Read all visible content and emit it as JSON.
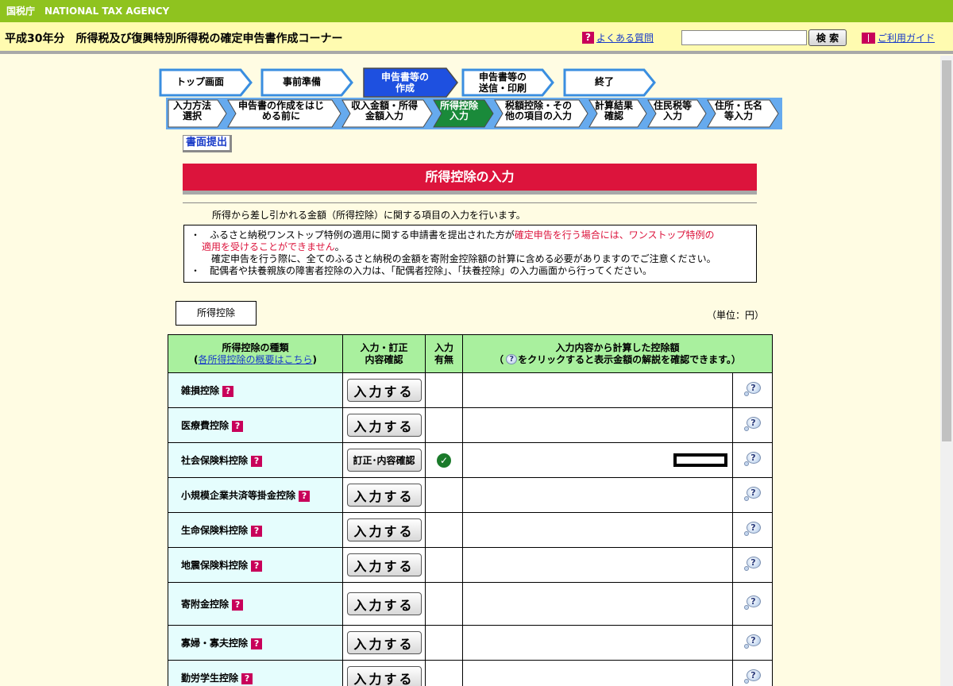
{
  "agency_header": "国税庁　NATIONAL TAX AGENCY",
  "main_title": "平成30年分　所得税及び復興特別所得税の確定申告書作成コーナー",
  "header": {
    "faq_label": "よくある質問",
    "search_placeholder": "",
    "search_button": "検 索",
    "guide_label": "ご利用ガイド"
  },
  "steps": [
    {
      "label": "トップ画面",
      "active": false
    },
    {
      "label": "事前準備",
      "active": false
    },
    {
      "label1": "申告書等の",
      "label2": "作成",
      "active": true
    },
    {
      "label1": "申告書等の",
      "label2": "送信・印刷",
      "active": false
    },
    {
      "label": "終了",
      "active": false
    }
  ],
  "substeps": [
    {
      "label1": "入力方法",
      "label2": "選択"
    },
    {
      "label1": "申告書の作成をはじ",
      "label2": "める前に"
    },
    {
      "label1": "収入金額・所得",
      "label2": "金額入力"
    },
    {
      "label1": "所得控除",
      "label2": "入力",
      "active": true
    },
    {
      "label1": "税額控除・その",
      "label2": "他の項目の入力"
    },
    {
      "label1": "計算結果",
      "label2": "確認"
    },
    {
      "label1": "住民税等",
      "label2": "入力"
    },
    {
      "label1": "住所・氏名",
      "label2": "等入力"
    }
  ],
  "paper_button": "書面提出",
  "section_title": "所得控除の入力",
  "intro": "所得から差し引かれる金額（所得控除）に関する項目の入力を行います。",
  "notice": {
    "line1_prefix": "・　ふるさと納税ワンストップ特例の適用に関する申請書を提出された方が",
    "line1_red": "確定申告を行う場合には、ワンストップ特例の",
    "line2_red": "適用を受けることができません",
    "line2_suffix": "。",
    "line3": "確定申告を行う際に、全てのふるさと納税の金額を寄附金控除額の計算に含める必要がありますのでご注意ください。",
    "line4": "・　配偶者や扶養親族の障害者控除の入力は、「配偶者控除」、「扶養控除」の入力画面から行ってください。"
  },
  "tab_label": "所得控除",
  "unit": "（単位：円）",
  "table": {
    "header_type": "所得控除の種類",
    "header_type_link": "各所得控除の概要はこちら",
    "header_input1": "入力・訂正",
    "header_input2": "内容確認",
    "header_flag1": "入力",
    "header_flag2": "有無",
    "header_amount1": "入力内容から計算した控除額",
    "header_amount2_prefix": "（",
    "header_amount2_suffix": "をクリックすると表示金額の解説を確認できます。）",
    "rows": [
      {
        "name": "雑損控除",
        "button": "入力する",
        "done": false
      },
      {
        "name": "医療費控除",
        "button": "入力する",
        "done": false
      },
      {
        "name": "社会保険料控除",
        "button": "訂正･内容確認",
        "done": true
      },
      {
        "name": "小規模企業共済等掛金控除",
        "button": "入力する",
        "done": false
      },
      {
        "name": "生命保険料控除",
        "button": "入力する",
        "done": false
      },
      {
        "name": "地震保険料控除",
        "button": "入力する",
        "done": false
      },
      {
        "name": "寄附金控除",
        "button": "入力する",
        "done": false
      },
      {
        "name": "寡婦・寡夫控除",
        "button": "入力する",
        "done": false
      },
      {
        "name": "勤労学生控除",
        "button": "入力する",
        "done": false
      }
    ]
  },
  "colors": {
    "top_green": "#8fc31f",
    "title_yellow": "#fffbb0",
    "section_red": "#dc143c",
    "table_header_green": "#a9f09e",
    "step_active": "#1e50e0",
    "substep_active": "#1a8a3a"
  }
}
